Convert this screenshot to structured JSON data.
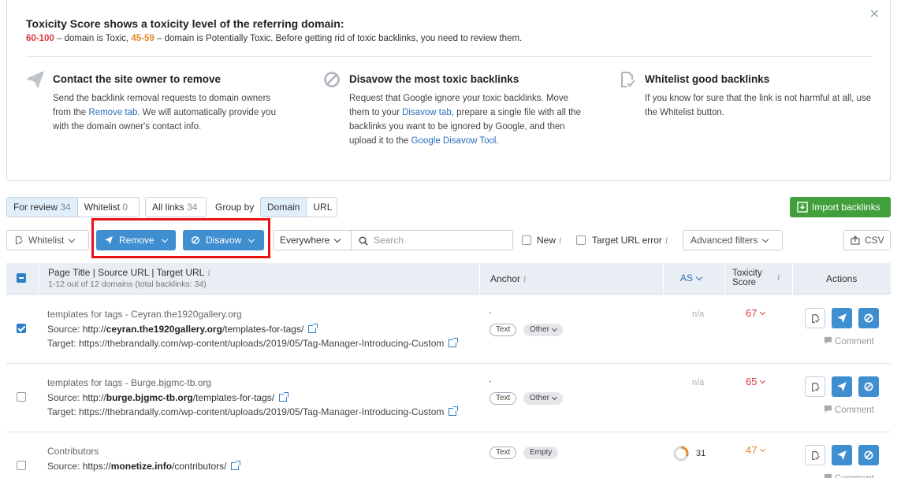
{
  "info": {
    "title": "Toxicity Score shows a toxicity level of the referring domain:",
    "toxic_range": "60-100",
    "toxic_text": " – domain is Toxic, ",
    "potential_range": "45-59",
    "potential_text": " – domain is Potentially Toxic. Before getting rid of toxic backlinks, you need to review them.",
    "close_icon": "close-icon",
    "columns": [
      {
        "icon": "paper-plane-icon",
        "title": "Contact the site owner to remove",
        "text_1": "Send the backlink removal requests to domain owners from the ",
        "link_1": "Remove tab",
        "text_2": ". We will automatically provide you with the domain owner's contact info."
      },
      {
        "icon": "ban-icon",
        "title": "Disavow the most toxic backlinks",
        "text_1": "Request that Google ignore your toxic backlinks. Move them to your ",
        "link_1": "Disavow tab",
        "text_2": ", prepare a single file with all the backlinks you want to be ignored by Google, and then upload it to the ",
        "link_2": "Google Disavow Tool",
        "text_3": "."
      },
      {
        "icon": "whitelist-icon",
        "title": "Whitelist good backlinks",
        "text_1": "If you know for sure that the link is not harmful at all, use the Whitelist button."
      }
    ]
  },
  "tabs": {
    "for_review_label": "For review",
    "for_review_count": "34",
    "whitelist_label": "Whitelist",
    "whitelist_count": "0",
    "all_links_label": "All links",
    "all_links_count": "34",
    "group_by_label": "Group by",
    "group_domain": "Domain",
    "group_url": "URL",
    "import_label": "Import backlinks"
  },
  "toolbar": {
    "whitelist_label": "Whitelist",
    "remove_label": "Remove",
    "disavow_label": "Disavow",
    "scope_value": "Everywhere",
    "search_placeholder": "Search",
    "new_label": "New",
    "target_error_label": "Target URL error",
    "advanced_filters_label": "Advanced filters",
    "csv_label": "CSV",
    "highlight_color": "#e11111"
  },
  "table": {
    "col_page": "Page Title | Source URL | Target URL",
    "col_page_sub": "1-12 out of 12 domains (total backlinks: 34)",
    "col_anchor": "Anchor",
    "col_as": "AS",
    "col_tox_1": "Toxicity",
    "col_tox_2": "Score",
    "col_actions": "Actions",
    "source_label": "Source: ",
    "target_label": "Target: ",
    "comment_label": "Comment",
    "rows": [
      {
        "checked": true,
        "title": "templates for tags - Ceyran.the1920gallery.org",
        "src_pre": "http://",
        "src_domain": "ceyran.the1920gallery.org",
        "src_post": "/templates-for-tags/",
        "target": "https://thebrandally.com/wp-content/uploads/2019/05/Tag-Manager-Introducing-Custom",
        "anchor": ".",
        "tag1": "Text",
        "tag2": "Other",
        "as": "n/a",
        "score": "67",
        "score_level": "toxic"
      },
      {
        "checked": false,
        "title": "templates for tags - Burge.bjgmc-tb.org",
        "src_pre": "http://",
        "src_domain": "burge.bjgmc-tb.org",
        "src_post": "/templates-for-tags/",
        "target": "https://thebrandally.com/wp-content/uploads/2019/05/Tag-Manager-Introducing-Custom",
        "anchor": ".",
        "tag1": "Text",
        "tag2": "Other",
        "as": "n/a",
        "score": "65",
        "score_level": "toxic"
      },
      {
        "checked": false,
        "title": "Contributors",
        "src_pre": "https://",
        "src_domain": "monetize.info",
        "src_post": "/contributors/",
        "target": "",
        "anchor": "",
        "tag1": "Text",
        "tag2": "Empty",
        "as": "31",
        "as_fraction": 0.31,
        "score": "47",
        "score_level": "potential"
      }
    ]
  },
  "colors": {
    "accent": "#3e8ed0",
    "import": "#41a03c",
    "toxic": "#d9373a",
    "potential": "#e8872b"
  }
}
